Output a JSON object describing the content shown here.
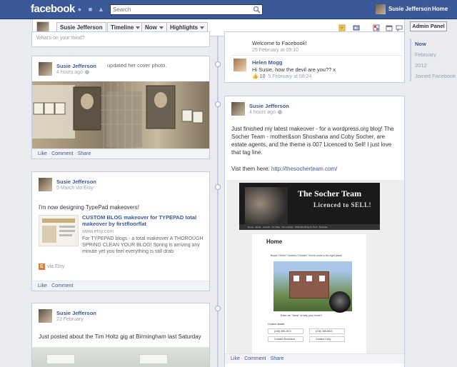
{
  "topbar": {
    "logo": "facebook",
    "search_placeholder": "Search",
    "user_name": "Susie Jefferson",
    "home": "Home"
  },
  "timeline_bar": {
    "name": "Susie Jefferson",
    "timeline": "Timeline",
    "now": "Now",
    "highlights": "Highlights"
  },
  "right_column": {
    "admin_button": "Admin Panel",
    "scrubber": [
      "Now",
      "February",
      "2012",
      "Joined Facebook"
    ]
  },
  "posts": {
    "cut_off_top": "What's on your mind?",
    "cover_photo": {
      "name": "Susie Jefferson",
      "action": "updated her cover photo.",
      "time": "4 hours ago",
      "actions": [
        "Like",
        "Comment",
        "Share"
      ]
    },
    "etsy": {
      "name": "Susie Jefferson",
      "meta": "5 March via Etsy",
      "text": "I'm now designing TypePad makeovers!",
      "link_title": "CUSTOM BLOG makeover for TYPEPAD total makeover by firstfloorflat",
      "link_domain": "www.etsy.com",
      "link_desc": "For TYPEPAD blogs - a total makeover A THOROUGH SPRING CLEAN YOUR BLOG! Spring is arriving any minute yet you feel everything is still drab",
      "via": "via Etsy",
      "actions": [
        "Like",
        "Comment"
      ]
    },
    "tim_holtz": {
      "name": "Susie Jefferson",
      "meta": "23 February",
      "text": "Just posted about the Tim Holtz gig at Birmingham last Saturday"
    },
    "welcome": {
      "text": "Welcome to Facebook!",
      "time": "25 February at 09:10",
      "commenter": "Helen Mogg",
      "comment": "Hi Susie, how the devil are you?? x",
      "likes": "10",
      "comment_time": "5 February at 08:24"
    },
    "makeover": {
      "name": "Susie Jefferson",
      "time": "4 hours ago",
      "text": "Just finished my latest makeover - for a wordpress.org blog! The Socher Team - mother&son Shoshana and Coby Socher, are estate agents, and the theme is 007 Licenced to Sell! I just love that tag line.",
      "visit_label": "Vist them here:",
      "visit_url": "http://thesocherteam.com/",
      "site_title": "The Socher Team",
      "site_tagline": "Licenced to SELL!",
      "site_nav": [
        "Home",
        "About",
        "Contact",
        "For Sale",
        "Our Listings",
        "What We Bring To You?",
        "Reviews"
      ],
      "site_heading": "Home",
      "site_intro": "Buyer? Seller? Investor? Renter? You've come to the right place!",
      "site_caption": "Enter our \"home\" to help your home!!",
      "site_contact_label": "Contact details",
      "site_contacts": [
        "(216) 455-1571",
        "(216) 308-8521",
        "Contact Shoshana",
        "Contact Coby"
      ],
      "actions": [
        "Like",
        "Comment",
        "Share"
      ]
    }
  }
}
